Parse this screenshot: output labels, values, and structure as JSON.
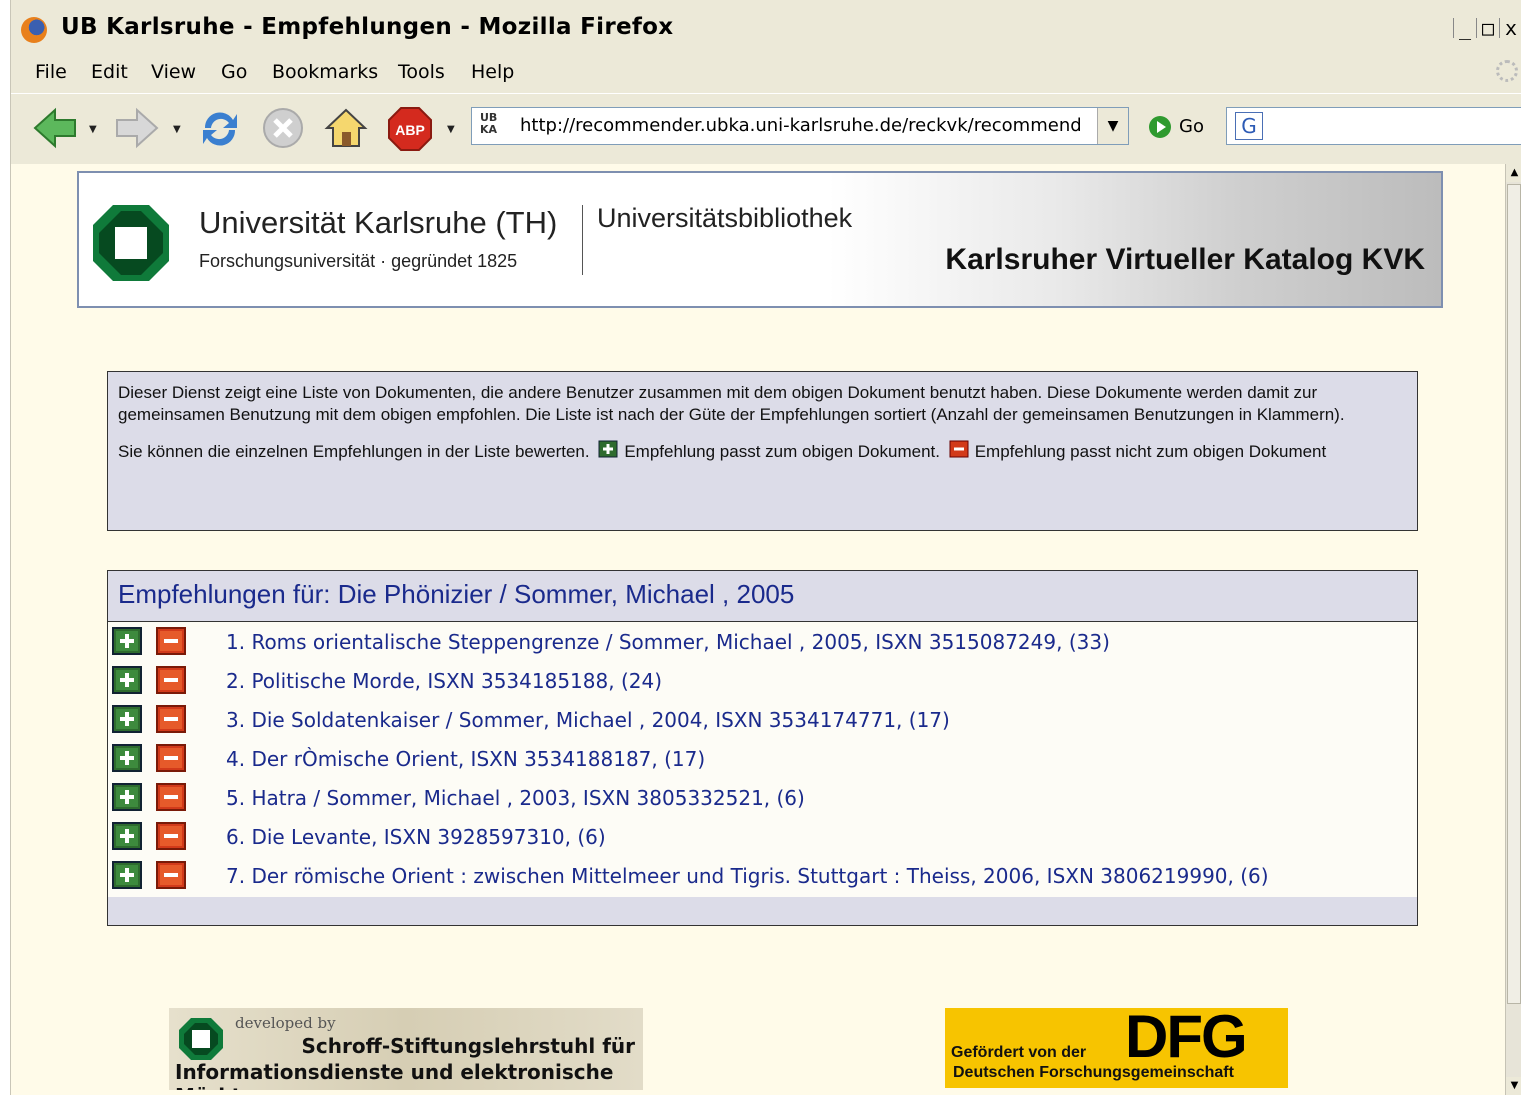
{
  "window": {
    "title": "UB Karlsruhe - Empfehlungen - Mozilla Firefox",
    "controls": [
      "_",
      "□",
      "x"
    ]
  },
  "menu": [
    "File",
    "Edit",
    "View",
    "Go",
    "Bookmarks",
    "Tools",
    "Help"
  ],
  "toolbar": {
    "url": "http://recommender.ubka.uni-karlsruhe.de/reckvk/recommenda",
    "ubka_label": "UB KA",
    "go_label": "Go",
    "abp_label": "ABP",
    "search_engine_letter": "G"
  },
  "banner": {
    "university": "Universität Karlsruhe (TH)",
    "subtitle": "Forschungsuniversität · gegründet 1825",
    "library": "Universitätsbibliothek",
    "catalog": "Karlsruher Virtueller Katalog KVK"
  },
  "info": {
    "paragraph1": "Dieser Dienst zeigt eine Liste von Dokumenten, die andere Benutzer zusammen mit dem obigen Dokument benutzt haben. Diese Dokumente werden damit zur gemeinsamen Benutzung mit dem obigen empfohlen. Die Liste ist nach der Güte der Empfehlungen sortiert (Anzahl der gemeinsamen Benutzungen in Klammern).",
    "rate_intro": "Sie können die einzelnen Empfehlungen in der Liste bewerten.",
    "plus_text": "Empfehlung passt zum obigen Dokument.",
    "minus_text": "Empfehlung passt nicht zum obigen Dokument"
  },
  "recommendations": {
    "heading": "Empfehlungen für: Die Phönizier / Sommer, Michael , 2005",
    "items": [
      "1. Roms orientalische Steppengrenze / Sommer, Michael , 2005, ISXN 3515087249, (33)",
      "2. Politische Morde, ISXN 3534185188, (24)",
      "3. Die Soldatenkaiser / Sommer, Michael , 2004, ISXN 3534174771, (17)",
      "4. Der rÒmische Orient, ISXN 3534188187, (17)",
      "5. Hatra / Sommer, Michael , 2003, ISXN 3805332521, (6)",
      "6. Die Levante, ISXN 3928597310, (6)",
      "7. Der römische Orient : zwischen Mittelmeer und Tigris. Stuttgart : Theiss, 2006, ISXN 3806219990, (6)"
    ]
  },
  "footer": {
    "developed_by": "developed by",
    "chair_line1": "Schroff-Stiftungslehrstuhl für",
    "chair_line2": "Informationsdienste und elektronische Märkte",
    "dfg_line1": "Gefördert von der",
    "dfg_line2": "Deutschen Forschungsgemeinschaft",
    "dfg_logo": "DFG"
  },
  "colors": {
    "page_bg": "#fffbe9",
    "panel_bg": "#dcdce8",
    "link": "#1a2a8c",
    "plus": "#2e6b2e",
    "minus": "#d23a1a",
    "dfg_yellow": "#f7c400"
  }
}
